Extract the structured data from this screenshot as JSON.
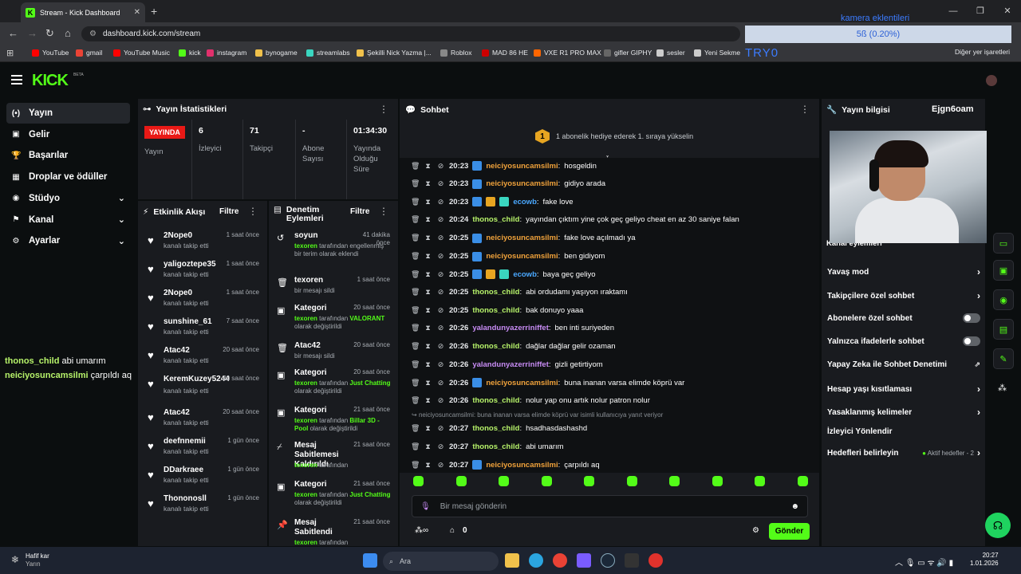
{
  "browser": {
    "tab_title": "Stream - Kick Dashboard",
    "url": "dashboard.kick.com/stream",
    "overlay_top": "kamera eklentileri",
    "overlay_bar": "5ß (0.20%)",
    "bookmark_right": "Diğer yer işaretleri",
    "overlay_tryo": "TRY0",
    "bookmarks": [
      "YouTube",
      "gmail",
      "YouTube Music",
      "kick",
      "instagram",
      "bynogame",
      "streamlabs",
      "Şekilli Nick Yazma |...",
      "Roblox",
      "MAD 86 HE",
      "VXE R1 PRO MAX",
      "gifler GIPHY",
      "sesler",
      "Yeni Sekme"
    ]
  },
  "sidebar": {
    "items": [
      {
        "label": "Yayın",
        "icon": "broadcast-icon"
      },
      {
        "label": "Gelir",
        "icon": "wallet-icon"
      },
      {
        "label": "Başarılar",
        "icon": "trophy-icon"
      },
      {
        "label": "Droplar ve ödüller",
        "icon": "gift-icon"
      },
      {
        "label": "Stüdyo",
        "icon": "studio-icon"
      },
      {
        "label": "Kanal",
        "icon": "channel-icon"
      },
      {
        "label": "Ayarlar",
        "icon": "gear-icon"
      }
    ]
  },
  "stats": {
    "title": "Yayın İstatistikleri",
    "live": "YAYINDA",
    "live_label": "Yayın",
    "cells": [
      {
        "v": "6",
        "l": "İzleyici"
      },
      {
        "v": "71",
        "l": "Takipçi"
      },
      {
        "v": "-",
        "l": "Abone Sayısı"
      },
      {
        "v": "01:34:30",
        "l": "Yayında Olduğu Süre"
      }
    ]
  },
  "activity": {
    "title": "Etkinlik Akışı",
    "filter": "Filtre",
    "rows": [
      {
        "n": "2Nope0",
        "s": "kanalı takip etti",
        "t": "1 saat önce"
      },
      {
        "n": "yaligoztepe35",
        "s": "kanalı takip etti",
        "t": "1 saat önce"
      },
      {
        "n": "2Nope0",
        "s": "kanalı takip etti",
        "t": "1 saat önce"
      },
      {
        "n": "sunshine_61",
        "s": "kanalı takip etti",
        "t": "7 saat önce"
      },
      {
        "n": "Atac42",
        "s": "kanalı takip etti",
        "t": "20 saat önce"
      },
      {
        "n": "KeremKuzey5244",
        "s": "kanalı takip etti",
        "t": "20 saat önce"
      },
      {
        "n": "Atac42",
        "s": "kanalı takip etti",
        "t": "20 saat önce"
      },
      {
        "n": "deefnnemii",
        "s": "kanalı takip etti",
        "t": "1 gün önce"
      },
      {
        "n": "DDarkraee",
        "s": "kanalı takip etti",
        "t": "1 gün önce"
      },
      {
        "n": "Thononosll",
        "s": "kanalı takip etti",
        "t": "1 gün önce"
      }
    ]
  },
  "moderation": {
    "title": "Denetim Eylemleri",
    "filter": "Filtre",
    "rows": [
      {
        "t": "soyun",
        "u": "texoren",
        "d": " tarafından engellenmiş bir terim olarak eklendi",
        "v": "",
        "tm": "41 dakika önce",
        "i": "undo-icon"
      },
      {
        "t": "texoren",
        "u": "",
        "d": "bir mesajı sildi",
        "v": "",
        "tm": "1 saat önce",
        "i": "trash-icon"
      },
      {
        "t": "Kategori",
        "u": "texoren",
        "d": " tarafından ",
        "v": "VALORANT",
        "d2": " olarak değiştirildi",
        "tm": "20 saat önce",
        "i": "category-icon"
      },
      {
        "t": "Atac42",
        "u": "",
        "d": "bir mesajı sildi",
        "v": "",
        "tm": "20 saat önce",
        "i": "trash-icon"
      },
      {
        "t": "Kategori",
        "u": "texoren",
        "d": " tarafından ",
        "v": "Just Chatting",
        "d2": " olarak değiştirildi",
        "tm": "20 saat önce",
        "i": "category-icon"
      },
      {
        "t": "Kategori",
        "u": "texoren",
        "d": " tarafından ",
        "v": "Billar 3D - Pool",
        "d2": " olarak değiştirildi",
        "tm": "21 saat önce",
        "i": "category-icon"
      },
      {
        "t": "Mesaj Sabitlemesi Kaldırıldı",
        "u": "texoren",
        "d": " tarafından",
        "v": "",
        "tm": "21 saat önce",
        "i": "unpin-icon"
      },
      {
        "t": "Kategori",
        "u": "texoren",
        "d": " tarafından ",
        "v": "Just Chatting",
        "d2": " olarak değiştirildi",
        "tm": "21 saat önce",
        "i": "category-icon"
      },
      {
        "t": "Mesaj Sabitlendi",
        "u": "texoren",
        "d": " tarafından",
        "v": "",
        "tm": "21 saat önce",
        "i": "pin-icon"
      }
    ]
  },
  "chat": {
    "title": "Sohbet",
    "goal": "1 abonelik hediye ederek 1. sıraya yükselin",
    "goal_num": "1",
    "messages": [
      {
        "tm": "20:23",
        "u": "neiciyosuncamsilmi",
        "c": "#f0a23b",
        "b": [
          "#3a8ee6"
        ],
        "m": "hosgeldin"
      },
      {
        "tm": "20:23",
        "u": "neiciyosuncamsilmi",
        "c": "#f0a23b",
        "b": [
          "#3a8ee6"
        ],
        "m": "gidiyo arada"
      },
      {
        "tm": "20:23",
        "u": "ecowb",
        "c": "#4aa8ff",
        "b": [
          "#3a8ee6",
          "#e7a521",
          "#3ad6c0"
        ],
        "m": "fake love"
      },
      {
        "tm": "20:24",
        "u": "thonos_child",
        "c": "#b7f36a",
        "b": [],
        "m": "yayından çıktım yine çok geç geliyo cheat en az 30 saniye falan"
      },
      {
        "tm": "20:25",
        "u": "neiciyosuncamsilmi",
        "c": "#f0a23b",
        "b": [
          "#3a8ee6"
        ],
        "m": "fake love açılmadı ya"
      },
      {
        "tm": "20:25",
        "u": "neiciyosuncamsilmi",
        "c": "#f0a23b",
        "b": [
          "#3a8ee6"
        ],
        "m": "ben gidiyom"
      },
      {
        "tm": "20:25",
        "u": "ecowb",
        "c": "#4aa8ff",
        "b": [
          "#3a8ee6",
          "#e7a521",
          "#3ad6c0"
        ],
        "m": "baya geç geliyo"
      },
      {
        "tm": "20:25",
        "u": "thonos_child",
        "c": "#b7f36a",
        "b": [],
        "m": "abi ordudamı yaşıyon ıraktamı"
      },
      {
        "tm": "20:25",
        "u": "thonos_child",
        "c": "#b7f36a",
        "b": [],
        "m": "bak donuyo yaaa"
      },
      {
        "tm": "20:26",
        "u": "yalandunyazerriniffet",
        "c": "#c88cf5",
        "b": [],
        "m": "ben inti suriyeden"
      },
      {
        "tm": "20:26",
        "u": "thonos_child",
        "c": "#b7f36a",
        "b": [],
        "m": "dağlar dağlar gelir ozaman"
      },
      {
        "tm": "20:26",
        "u": "yalandunyazerriniffet",
        "c": "#c88cf5",
        "b": [],
        "m": "gizli getirtiyom"
      },
      {
        "tm": "20:26",
        "u": "neiciyosuncamsilmi",
        "c": "#f0a23b",
        "b": [
          "#3a8ee6"
        ],
        "m": "buna inanan varsa elimde köprü var"
      },
      {
        "tm": "20:26",
        "u": "thonos_child",
        "c": "#b7f36a",
        "b": [],
        "m": "nolur yap onu artık nolur patron nolur"
      },
      {
        "tm": "20:27",
        "u": "thonos_child",
        "c": "#b7f36a",
        "b": [],
        "m": "hsadhasdashashd"
      },
      {
        "tm": "20:27",
        "u": "thonos_child",
        "c": "#b7f36a",
        "b": [],
        "m": "abi umarım"
      },
      {
        "tm": "20:27",
        "u": "neiciyosuncamsilmi",
        "c": "#f0a23b",
        "b": [
          "#3a8ee6"
        ],
        "m": "çarpıldı aq"
      }
    ],
    "reply_note": "neiciyosuncamsilmi: buna inanan varsa elimde köprü var isimli kullanıcıya yanıt veriyor",
    "placeholder": "Bir mesaj gönderin",
    "points": "0",
    "send": "Gönder"
  },
  "info": {
    "title": "Yayın bilgisi",
    "brand": "Ejgn6oam",
    "actions_title": "Kanal eylemleri",
    "rows": [
      {
        "l": "Yavaş mod",
        "k": "chev"
      },
      {
        "l": "Takipçilere özel sohbet",
        "k": "chev"
      },
      {
        "l": "Abonelere özel sohbet",
        "k": "tog"
      },
      {
        "l": "Yalnızca ifadelerle sohbet",
        "k": "tog"
      },
      {
        "l": "Yapay Zeka ile Sohbet Denetimi",
        "k": "ext"
      },
      {
        "l": "Hesap yaşı kısıtlaması",
        "k": "chev"
      },
      {
        "l": "Yasaklanmış kelimeler",
        "k": "chev"
      },
      {
        "l": "İzleyici Yönlendir",
        "k": ""
      },
      {
        "l": "Hedefleri belirleyin",
        "k": "goal"
      }
    ],
    "goal_text": "Aktif hedefler - 2"
  },
  "overlay_chat": [
    {
      "u": "thonos_child",
      "m": "abi umarım"
    },
    {
      "u": "neiciyosuncamsilmi",
      "m": "çarpıldı aq"
    }
  ],
  "taskbar": {
    "weather1": "Hafif kar",
    "weather2": "Yarın",
    "search": "Ara",
    "time": "20:27",
    "date": "1.01.2026"
  }
}
